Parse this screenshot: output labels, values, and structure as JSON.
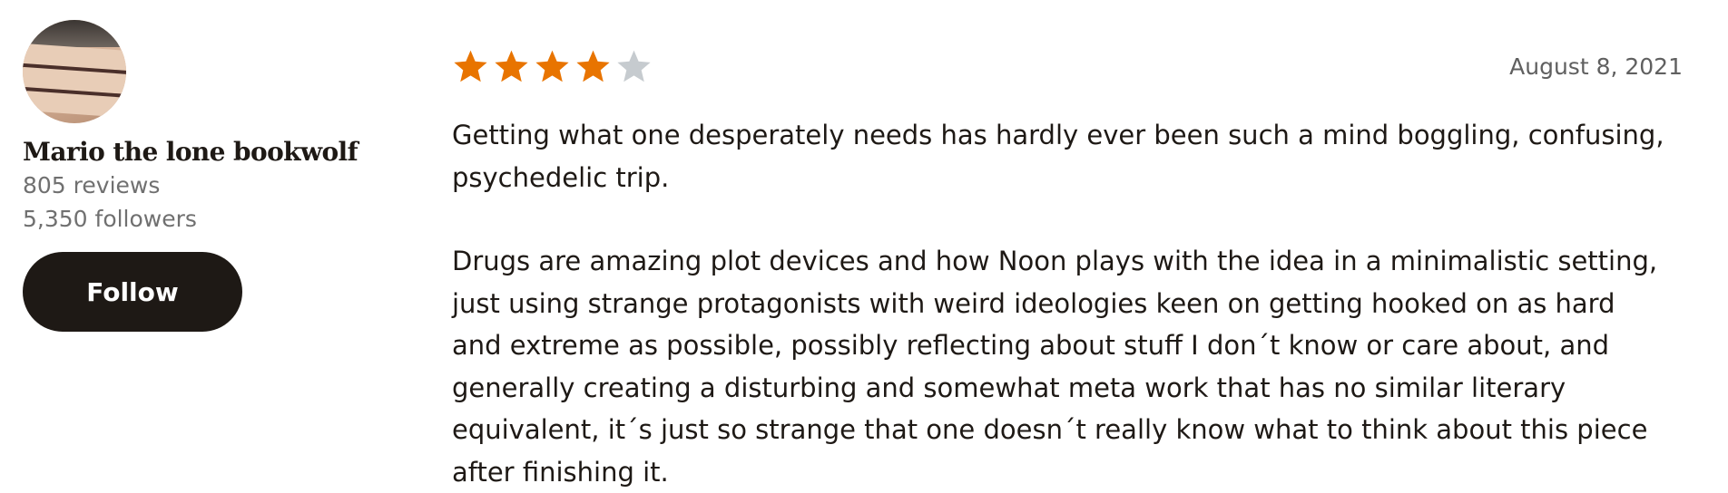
{
  "reviewer": {
    "name": "Mario the lone bookwolf",
    "reviews": "805 reviews",
    "followers": "5,350 followers",
    "follow_label": "Follow"
  },
  "review": {
    "rating": 4,
    "max_rating": 5,
    "date": "August 8, 2021",
    "paragraphs": [
      "Getting what one desperately needs has hardly ever been such a mind boggling, confusing, psychedelic trip.",
      "Drugs are amazing plot devices and how Noon plays with the idea in a minimalistic setting, just using strange protagonists with weird ideologies keen on getting hooked on as hard and extreme as possible, possibly reflecting about stuff I don´t know or care about, and generally creating a disturbing and somewhat meta work that has no similar literary equivalent, it´s just so strange that one doesn´t really know what to think about this piece after finishing it."
    ]
  },
  "colors": {
    "star_filled": "#e87400",
    "star_empty": "#c6cbcf",
    "button_bg": "#1e1915",
    "text": "#1e1915",
    "muted": "#707070"
  },
  "icons": {
    "star": "star-icon"
  }
}
